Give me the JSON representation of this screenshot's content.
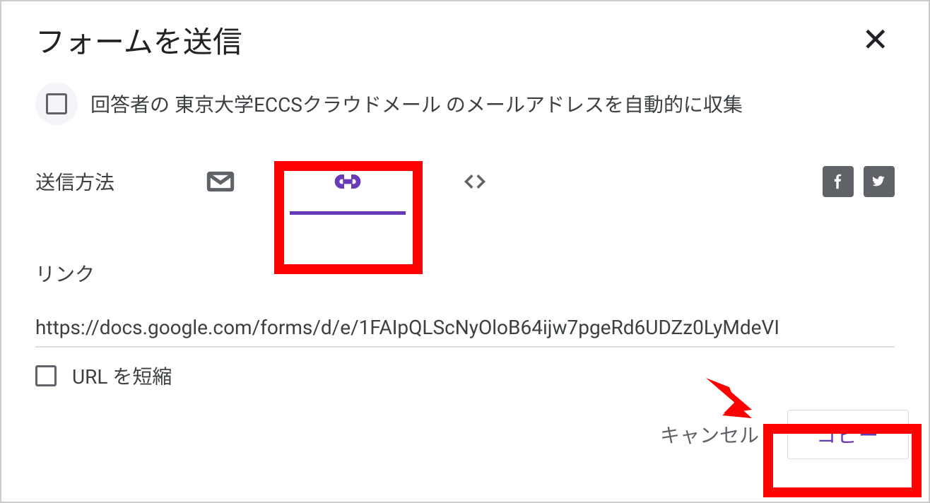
{
  "dialog": {
    "title": "フォームを送信",
    "collect_email_label": "回答者の 東京大学ECCSクラウドメール のメールアドレスを自動的に収集",
    "send_method_label": "送信方法",
    "link_section_title": "リンク",
    "link_url": "https://docs.google.com/forms/d/e/1FAIpQLScNyOloB64ijw7pgeRd6UDZz0LyMdeVI",
    "shorten_url_label": "URL を短縮",
    "cancel_label": "キャンセル",
    "copy_label": "コピー"
  },
  "colors": {
    "accent": "#673ab7",
    "annotation": "#ff0000"
  }
}
